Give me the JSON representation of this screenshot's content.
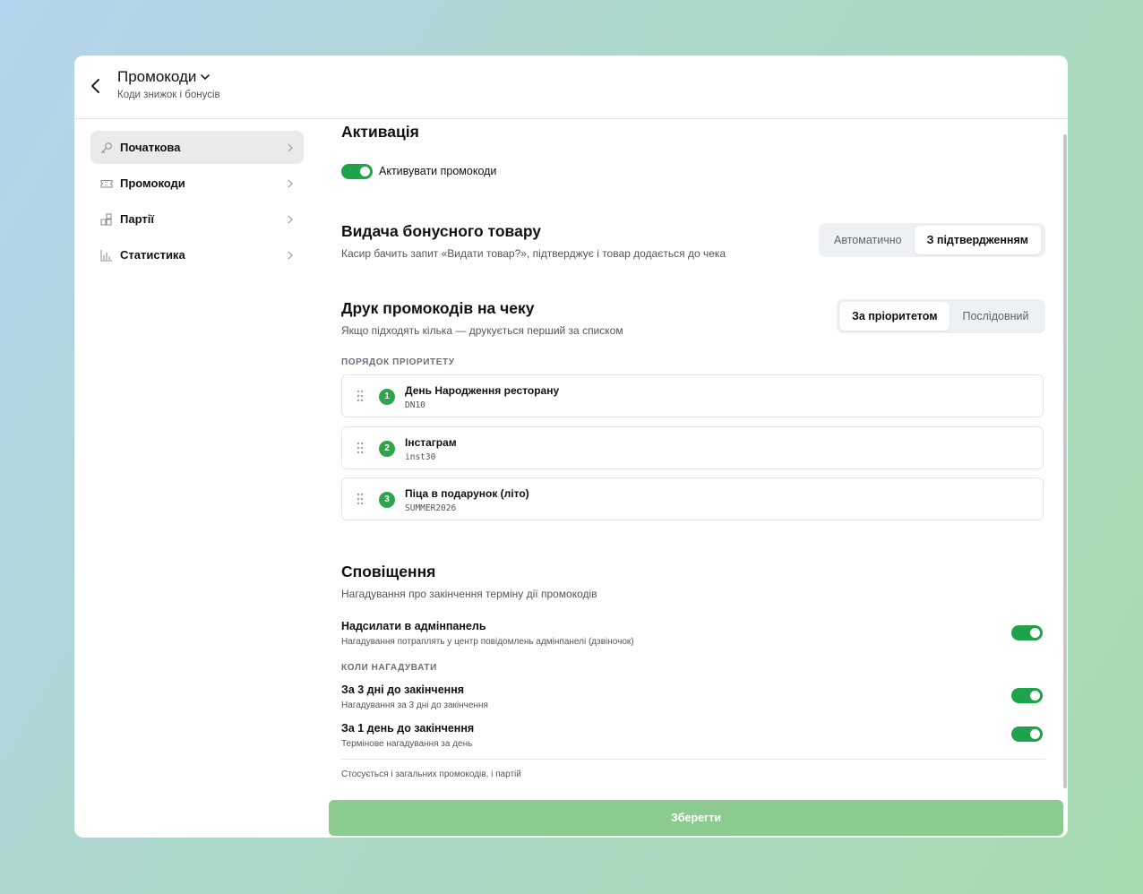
{
  "header": {
    "title": "Промокоди",
    "subtitle": "Коди знижок і бонусів"
  },
  "sidebar": {
    "items": [
      {
        "label": "Початкова",
        "icon": "key-icon",
        "active": true
      },
      {
        "label": "Промокоди",
        "icon": "ticket-icon",
        "active": false
      },
      {
        "label": "Партії",
        "icon": "boxes-icon",
        "active": false
      },
      {
        "label": "Статистика",
        "icon": "bar-chart-icon",
        "active": false
      }
    ]
  },
  "activation": {
    "title": "Активація",
    "toggle_label": "Активувати промокоди",
    "enabled": true
  },
  "bonus": {
    "title": "Видача бонусного товару",
    "description": "Касир бачить запит «Видати товар?», підтверджує і товар додається до чека",
    "options": [
      "Автоматично",
      "З підтвердженням"
    ],
    "selected": "З підтвердженням"
  },
  "printing": {
    "title": "Друк промокодів на чеку",
    "description": "Якщо підходять кілька — друкується перший за списком",
    "options": [
      "За пріоритетом",
      "Послідовний"
    ],
    "selected": "За пріоритетом",
    "priority_label": "ПОРЯДОК ПРІОРИТЕТУ",
    "priority": [
      {
        "num": "1",
        "name": "День Народження ресторану",
        "code": "DN10"
      },
      {
        "num": "2",
        "name": "Інстаграм",
        "code": "inst30"
      },
      {
        "num": "3",
        "name": "Піца в подарунок (літо)",
        "code": "SUMMER2026"
      }
    ]
  },
  "notifications": {
    "title": "Сповіщення",
    "description": "Нагадування про закінчення терміну дії промокодів",
    "admin": {
      "title": "Надсилати в адмінпанель",
      "sub": "Нагадування потраплять у центр повідомлень адмінпанелі (дзвіночок)",
      "enabled": true
    },
    "when_label": "КОЛИ НАГАДУВАТИ",
    "day3": {
      "title": "За 3 дні до закінчення",
      "sub": "Нагадування за 3 дні до закінчення",
      "enabled": true
    },
    "day1": {
      "title": "За 1 день до закінчення",
      "sub": "Термінове нагадування за день",
      "enabled": true
    },
    "footnote": "Стосується і загальних промокодів, і партій"
  },
  "save_label": "Зберегти",
  "colors": {
    "accent": "#1fa34a",
    "save_button": "#8ccb8f"
  }
}
